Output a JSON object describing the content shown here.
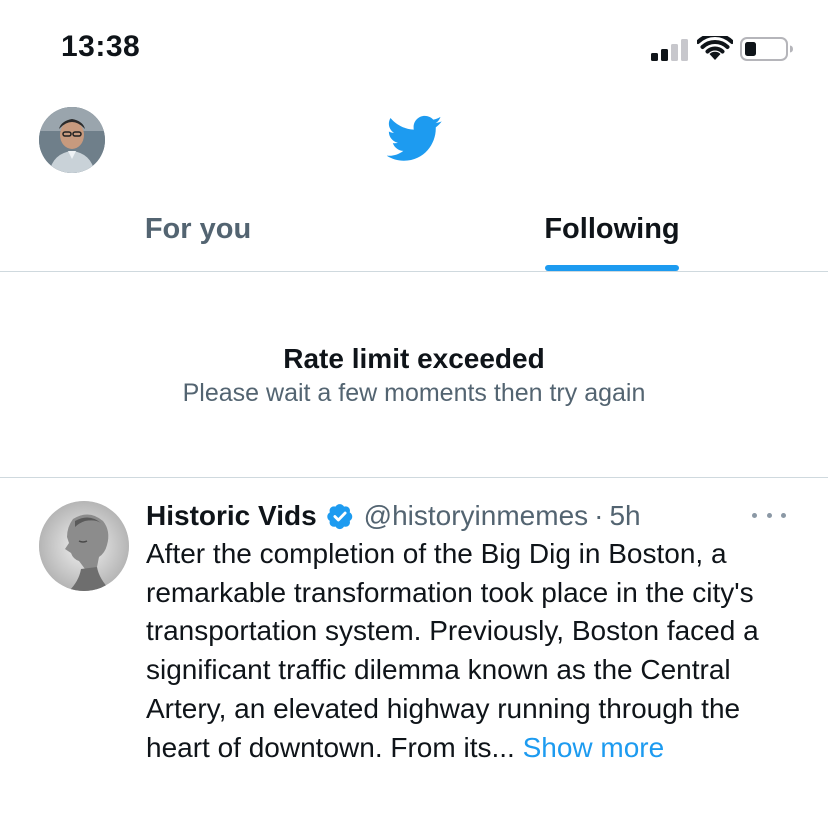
{
  "status_bar": {
    "time": "13:38"
  },
  "header": {
    "logo_icon": "twitter-bird-icon",
    "brand_color": "#1d9bf0"
  },
  "tabs": [
    {
      "label": "For you",
      "selected": false
    },
    {
      "label": "Following",
      "selected": true
    }
  ],
  "notice": {
    "title": "Rate limit exceeded",
    "subtitle": "Please wait a few moments then try again"
  },
  "tweet": {
    "author_name": "Historic Vids",
    "handle": "@historyinmemes",
    "separator": "·",
    "time": "5h",
    "verified": true,
    "text": "After the completion of the Big Dig in Boston, a remarkable transformation took place in the city's transportation system. Previously, Boston faced a significant traffic dilemma known as the Central Artery, an elevated highway running through the heart of downtown. From its...",
    "show_more": "Show more"
  }
}
